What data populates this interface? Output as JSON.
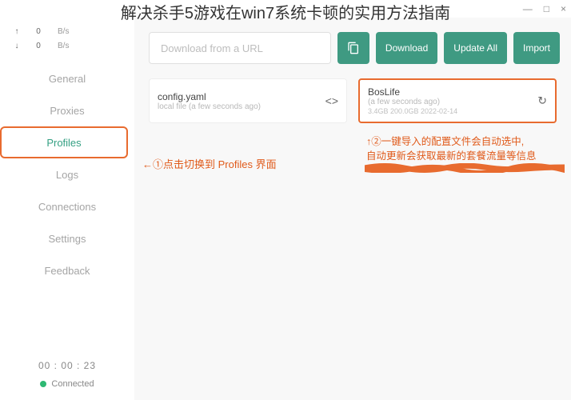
{
  "overlay_title": "解决杀手5游戏在win7系统卡顿的实用方法指南",
  "window": {
    "min": "—",
    "max": "□",
    "close": "×"
  },
  "traffic": {
    "up": {
      "arrow": "↑",
      "val": "0",
      "unit": "B/s"
    },
    "down": {
      "arrow": "↓",
      "val": "0",
      "unit": "B/s"
    }
  },
  "nav": {
    "general": "General",
    "proxies": "Proxies",
    "profiles": "Profiles",
    "logs": "Logs",
    "connections": "Connections",
    "settings": "Settings",
    "feedback": "Feedback"
  },
  "timer": "00 : 00 : 23",
  "status": {
    "label": "Connected"
  },
  "url_placeholder": "Download from a URL",
  "buttons": {
    "download": "Download",
    "update_all": "Update All",
    "import": "Import"
  },
  "cards": {
    "local": {
      "title": "config.yaml",
      "sub": "local file (a few seconds ago)",
      "action": "<>"
    },
    "remote": {
      "title": "BosLife",
      "sub": "(a few seconds ago)",
      "meta": "3.4GB   200.0GB   2022-02-14",
      "action": "↻"
    }
  },
  "annotations": {
    "a1": "←①点击切换到 Profiles 界面",
    "a2_l1": "↑②一键导入的配置文件会自动选中,",
    "a2_l2": "自动更新会获取最新的套餐流量等信息"
  }
}
